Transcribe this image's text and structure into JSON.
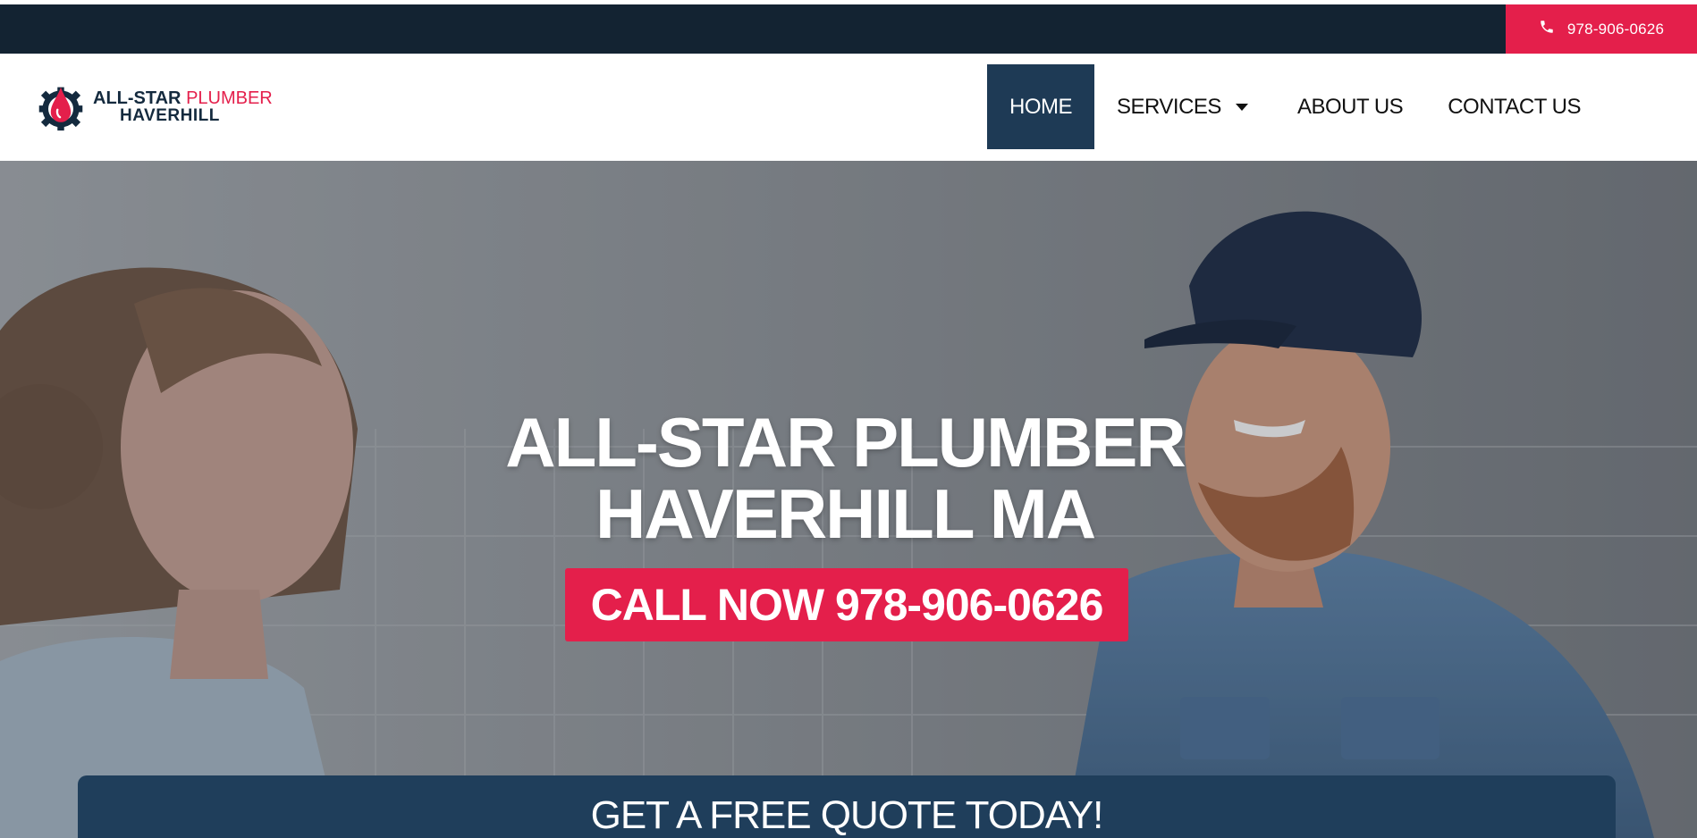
{
  "topbar": {
    "phone_icon": "phone-icon",
    "phone": "978-906-0626"
  },
  "logo": {
    "icon": "gear-water-drop-icon",
    "line1_a": "ALL-STAR",
    "line1_b": "PLUMBER",
    "line2": "HAVERHILL"
  },
  "nav": {
    "items": [
      {
        "label": "HOME",
        "active": true
      },
      {
        "label": "SERVICES",
        "has_dropdown": true
      },
      {
        "label": "ABOUT US"
      },
      {
        "label": "CONTACT US"
      }
    ]
  },
  "hero": {
    "title_line1": "ALL-STAR PLUMBER",
    "title_line2": "HAVERHILL MA",
    "cta_label": "CALL NOW 978-906-0626"
  },
  "quote": {
    "title": "GET A FREE QUOTE TODAY!"
  },
  "colors": {
    "navy": "#132332",
    "accent": "#e41f4b",
    "nav_active": "#1e3a55",
    "quote_panel": "#1f3e5b"
  }
}
